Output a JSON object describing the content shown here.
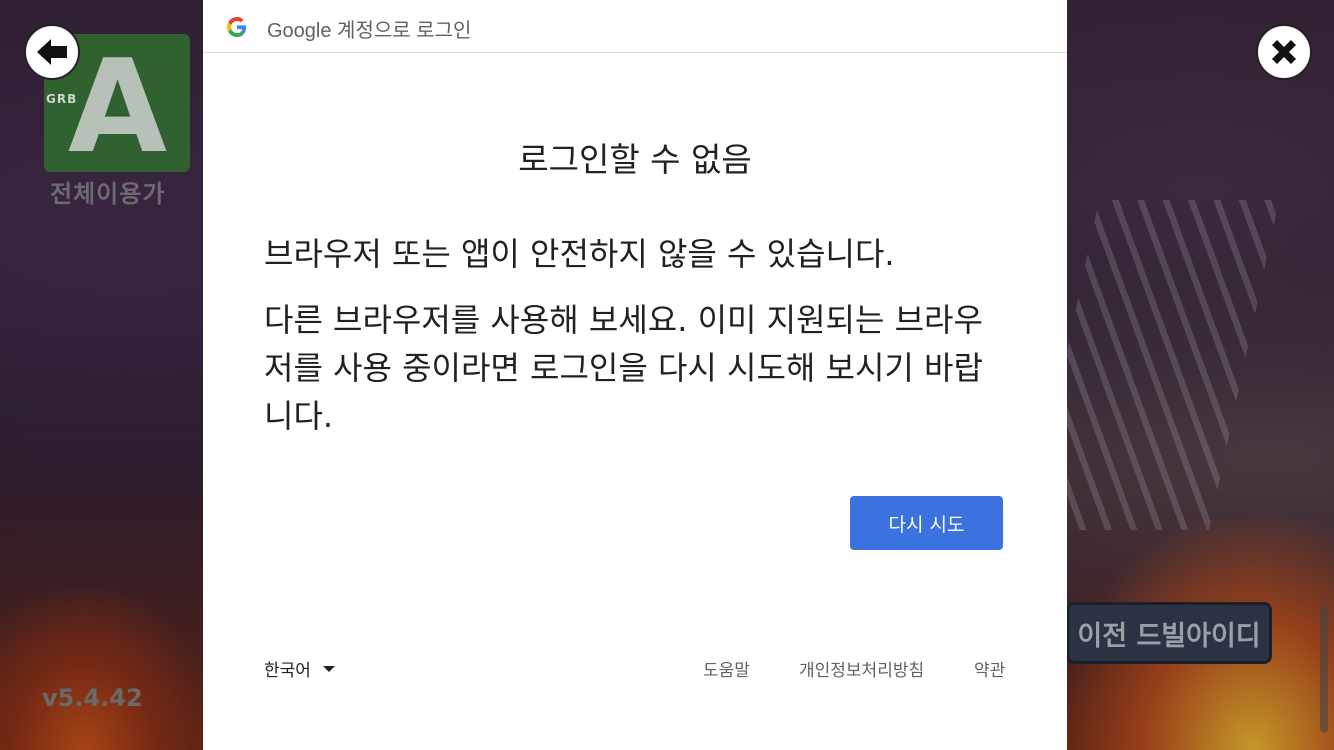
{
  "game": {
    "rating_org": "GRB",
    "rating_mark": "A",
    "rating_label": "전체이용가",
    "version": "v5.4.42",
    "action_button": "이전 드빌아이디",
    "back_icon": "arrow-left-icon",
    "close_icon": "close-icon"
  },
  "dialog": {
    "header_title": "Google 계정으로 로그인",
    "title": "로그인할 수 없음",
    "message_1": "브라우저 또는 앱이 안전하지 않을 수 있습니다.",
    "message_2": "다른 브라우저를 사용해 보세요. 이미 지원되는 브라우저를 사용 중이라면 로그인을 다시 시도해 보시기 바랍니다.",
    "retry_button": "다시 시도",
    "accent_color": "#3b72e0"
  },
  "footer": {
    "language": "한국어",
    "help": "도움말",
    "privacy": "개인정보처리방침",
    "terms": "약관"
  }
}
